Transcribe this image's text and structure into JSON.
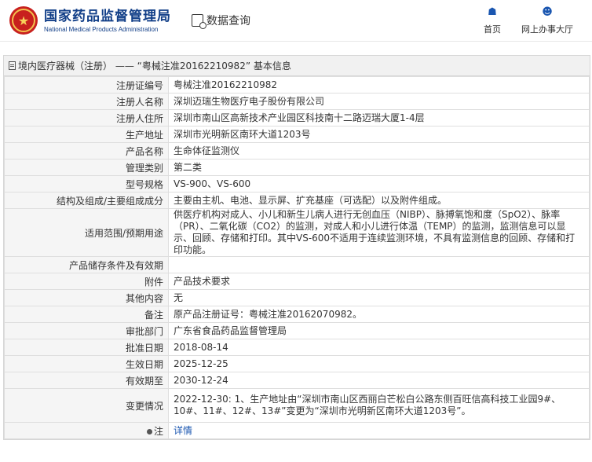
{
  "header": {
    "site_name_cn": "国家药品监督管理局",
    "site_name_en": "National Medical Products Administration",
    "query_label": "数据查询",
    "nav": [
      {
        "label": "首页",
        "icon": "home-icon"
      },
      {
        "label": "网上办事大厅",
        "icon": "user-icon"
      }
    ]
  },
  "panel": {
    "title": "境内医疗器械（注册） —— “粤械注准20162210982” 基本信息"
  },
  "rows": [
    {
      "key": "注册证编号",
      "value": "粤械注准20162210982"
    },
    {
      "key": "注册人名称",
      "value": "深圳迈瑞生物医疗电子股份有限公司"
    },
    {
      "key": "注册人住所",
      "value": "深圳市南山区高新技术产业园区科技南十二路迈瑞大厦1-4层"
    },
    {
      "key": "生产地址",
      "value": "深圳市光明新区南环大道1203号"
    },
    {
      "key": "产品名称",
      "value": "生命体征监测仪"
    },
    {
      "key": "管理类别",
      "value": "第二类"
    },
    {
      "key": "型号规格",
      "value": "VS-900、VS-600"
    },
    {
      "key": "结构及组成/主要组成成分",
      "value": "主要由主机、电池、显示屏、扩充基座（可选配）以及附件组成。"
    },
    {
      "key": "适用范围/预期用途",
      "value": "供医疗机构对成人、小儿和新生儿病人进行无创血压（NIBP）、脉搏氧饱和度（SpO2）、脉率（PR）、二氧化碳（CO2）的监测，对成人和小儿进行体温（TEMP）的监测，监测信息可以显示、回顾、存储和打印。其中VS-600不适用于连续监测环境，不具有监测信息的回顾、存储和打印功能。"
    },
    {
      "key": "产品储存条件及有效期",
      "value": ""
    },
    {
      "key": "附件",
      "value": "产品技术要求"
    },
    {
      "key": "其他内容",
      "value": "无"
    },
    {
      "key": "备注",
      "value": "原产品注册证号：粤械注准20162070982。"
    },
    {
      "key": "审批部门",
      "value": "广东省食品药品监督管理局"
    },
    {
      "key": "批准日期",
      "value": "2018-08-14"
    },
    {
      "key": "生效日期",
      "value": "2025-12-25"
    },
    {
      "key": "有效期至",
      "value": "2030-12-24"
    },
    {
      "key": "变更情况",
      "value": "2022-12-30: 1、生产地址由“深圳市南山区西丽白芒松白公路东侧百旺信高科技工业园9#、10#、11#、12#、13#”变更为“深圳市光明新区南环大道1203号”。"
    }
  ],
  "note": {
    "key": "注",
    "link": "详情"
  }
}
